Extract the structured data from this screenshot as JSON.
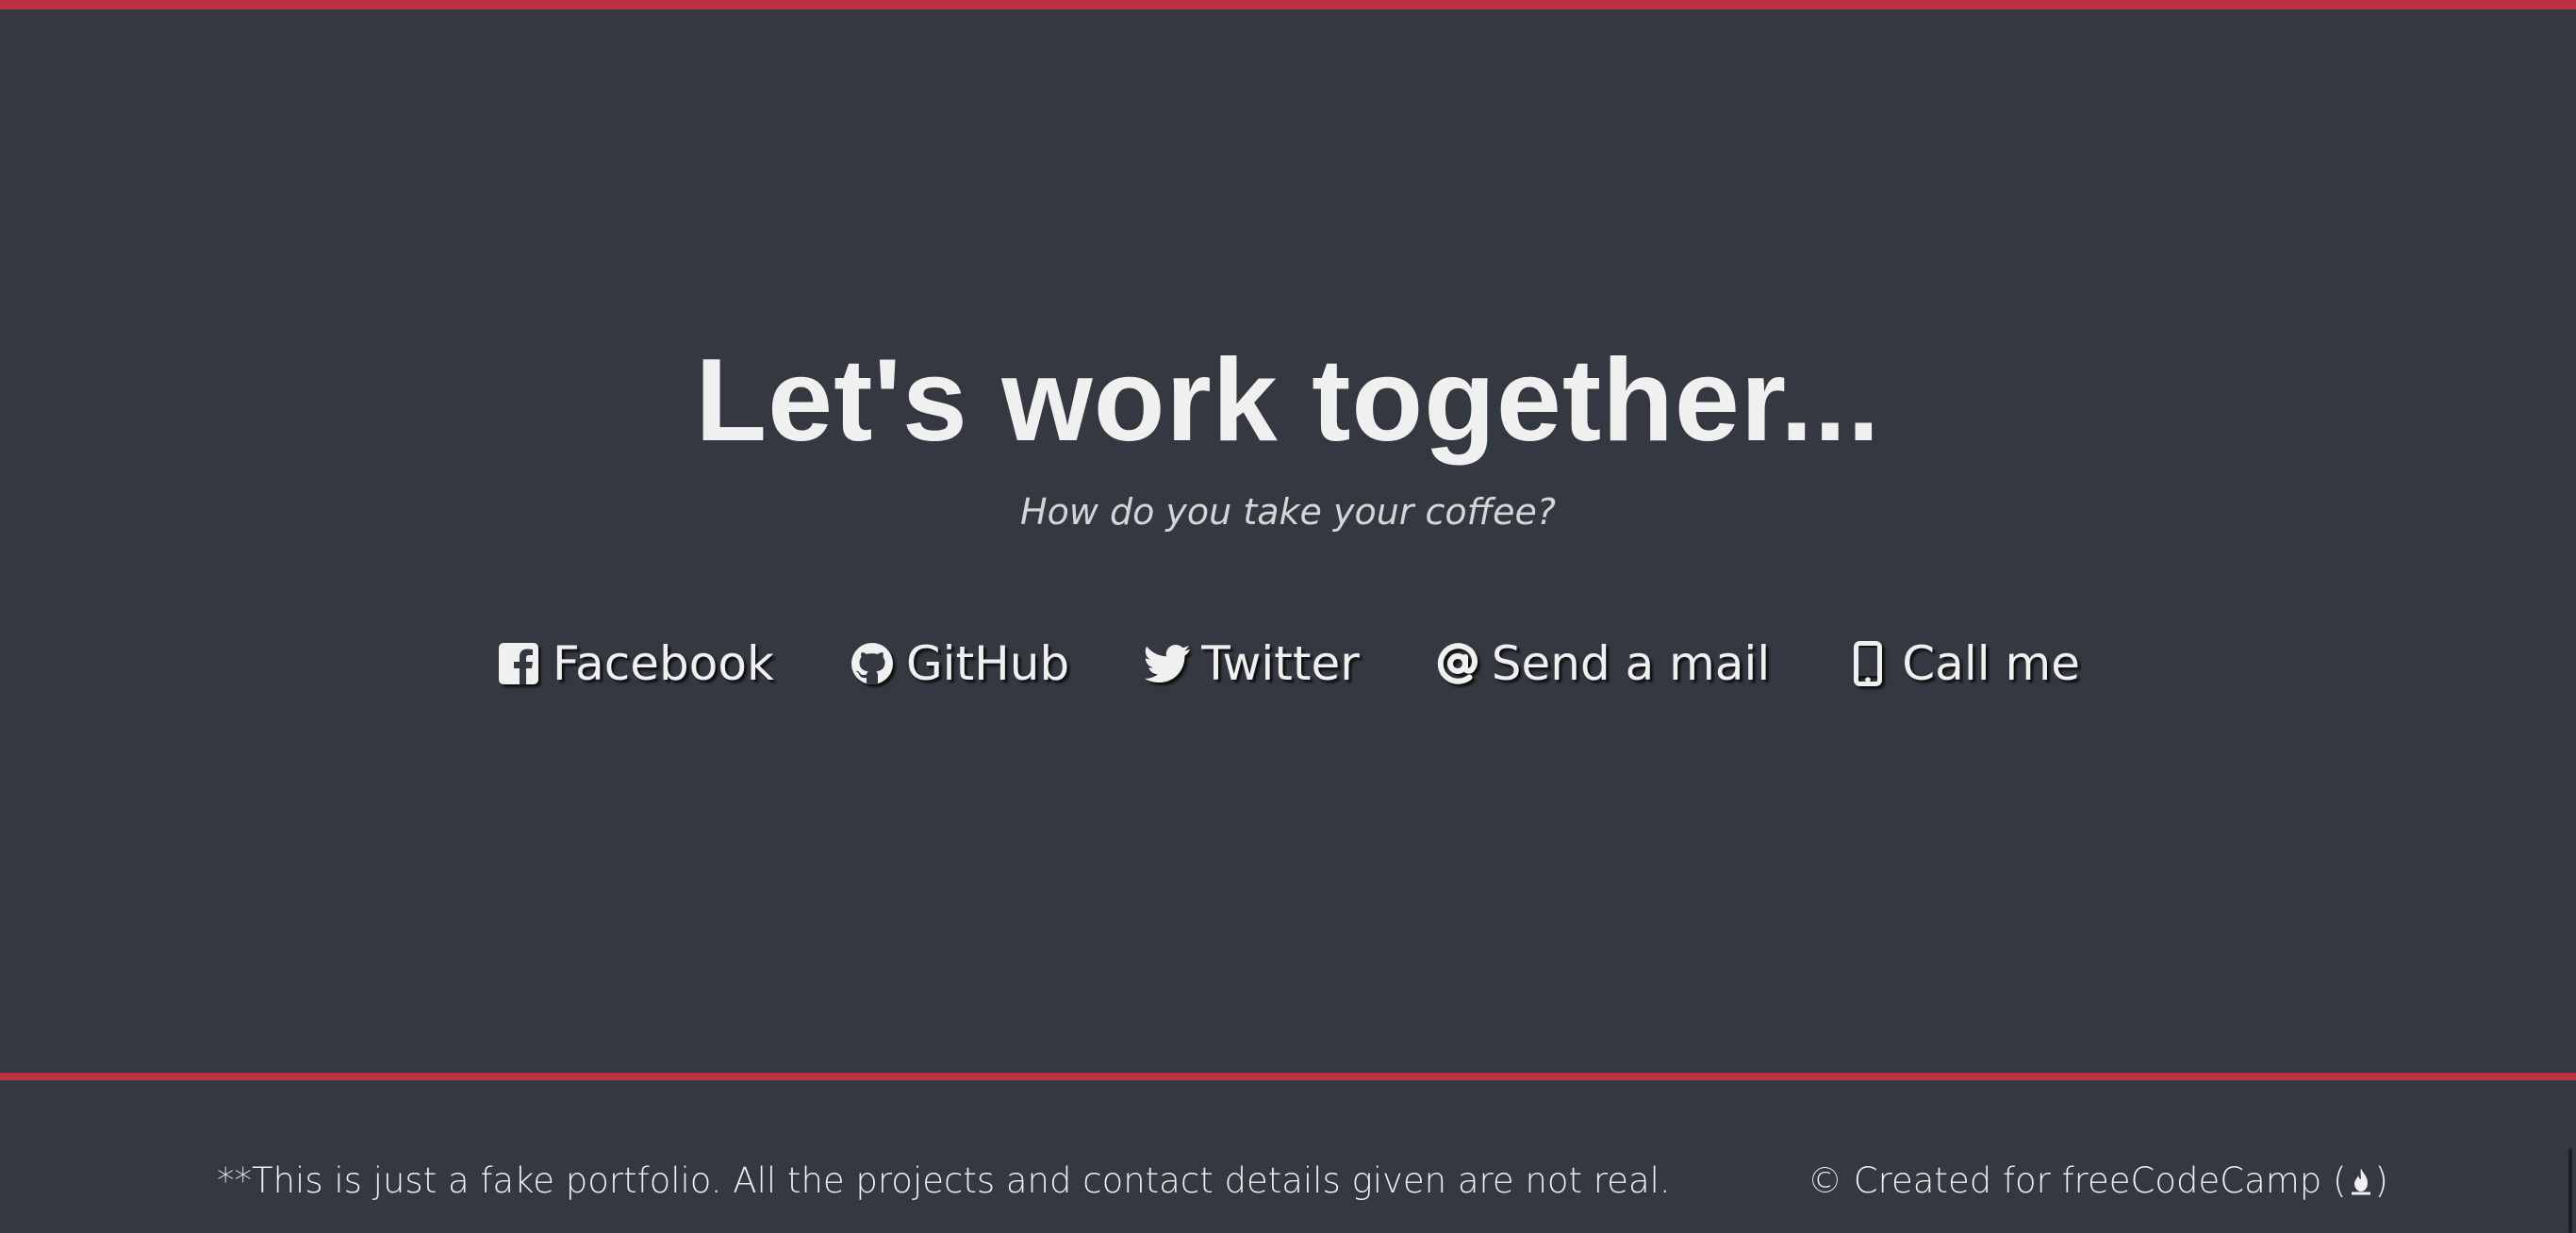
{
  "contact": {
    "headline": "Let's work together...",
    "subtitle": "How do you take your coffee?",
    "links": [
      {
        "label": "Facebook",
        "icon": "facebook-square-icon"
      },
      {
        "label": "GitHub",
        "icon": "github-icon"
      },
      {
        "label": "Twitter",
        "icon": "twitter-icon"
      },
      {
        "label": "Send a mail",
        "icon": "at-sign-icon"
      },
      {
        "label": "Call me",
        "icon": "mobile-phone-icon"
      }
    ]
  },
  "footer": {
    "disclaimer": "**This is just a fake portfolio. All the projects and contact details given are not real.",
    "credit_prefix": "© Created for freeCodeCamp (",
    "credit_suffix": ")",
    "credit_icon": "free-code-camp-fire-icon"
  },
  "colors": {
    "background": "#333841",
    "accent_border": "#be3144",
    "text": "#f0f0f0"
  }
}
